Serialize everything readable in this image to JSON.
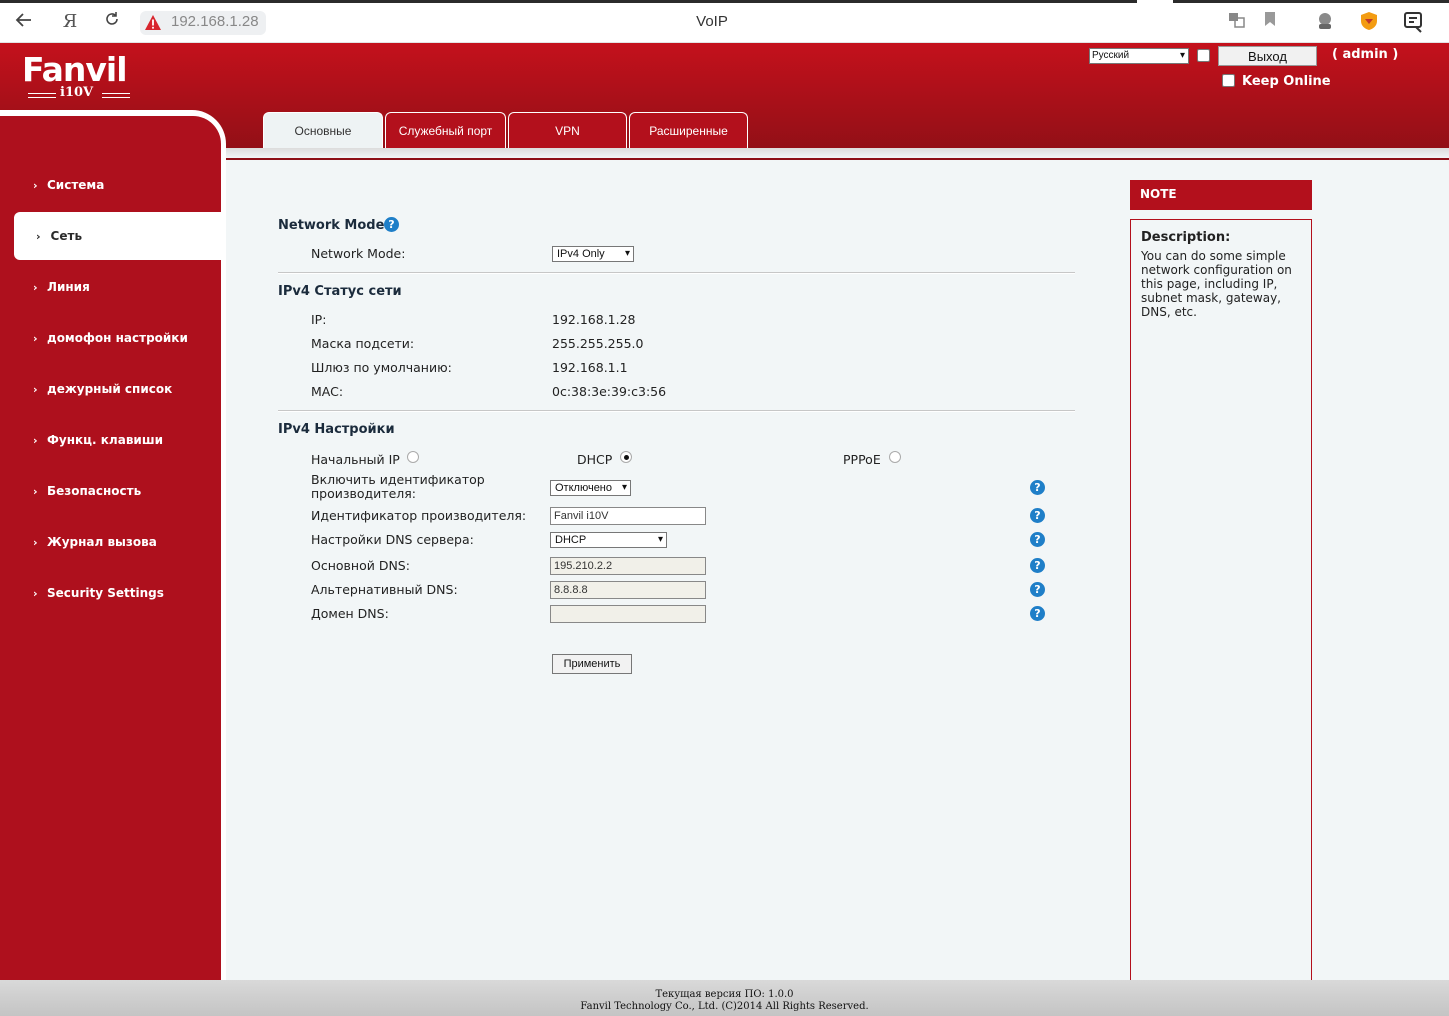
{
  "browser": {
    "url": "192.168.1.28",
    "tab_title": "VoIP",
    "icons": [
      "back-arrow-icon",
      "yandex-icon",
      "reload-icon",
      "warning-icon",
      "translate-icon",
      "bookmark-icon",
      "extension-icon",
      "shield-icon",
      "menu-icon"
    ]
  },
  "header": {
    "logo_brand": "Fanvil",
    "logo_model": "i10V",
    "language": "Русский",
    "logout_label": "Выход",
    "user_label": "( admin )",
    "keep_online_label": "Keep Online"
  },
  "tabs": [
    {
      "label": "Основные",
      "active": true
    },
    {
      "label": "Служебный порт",
      "active": false
    },
    {
      "label": "VPN",
      "active": false
    },
    {
      "label": "Расширенные",
      "active": false
    }
  ],
  "sidebar": {
    "items": [
      {
        "label": "Система"
      },
      {
        "label": "Сеть",
        "active": true
      },
      {
        "label": "Линия"
      },
      {
        "label": "домофон настройки"
      },
      {
        "label": "дежурный список"
      },
      {
        "label": "Функц. клавиши"
      },
      {
        "label": "Безопасность"
      },
      {
        "label": "Журнал вызова"
      },
      {
        "label": "Security Settings"
      }
    ]
  },
  "network_mode": {
    "title": "Network Mode",
    "label": "Network Mode:",
    "value": "IPv4 Only"
  },
  "ipv4_status": {
    "title": "IPv4 Статус сети",
    "rows": [
      {
        "label": "IP:",
        "value": "192.168.1.28"
      },
      {
        "label": "Маска подсети:",
        "value": "255.255.255.0"
      },
      {
        "label": "Шлюз по умолчанию:",
        "value": "192.168.1.1"
      },
      {
        "label": "MAC:",
        "value": "0c:38:3e:39:c3:56"
      }
    ]
  },
  "ipv4_settings": {
    "title": "IPv4 Настройки",
    "modes": [
      {
        "label": "Начальный IP",
        "selected": false
      },
      {
        "label": "DHCP",
        "selected": true
      },
      {
        "label": "PPPoE",
        "selected": false
      }
    ],
    "vendor_enable_label_1": "Включить идентификатор",
    "vendor_enable_label_2": "производителя:",
    "vendor_enable_value": "Отключено",
    "vendor_id_label": "Идентификатор производителя:",
    "vendor_id_value": "Fanvil i10V",
    "dns_mode_label": "Настройки DNS сервера:",
    "dns_mode_value": "DHCP",
    "primary_dns_label": "Основной DNS:",
    "primary_dns_value": "195.210.2.2",
    "alt_dns_label": "Альтернативный DNS:",
    "alt_dns_value": "8.8.8.8",
    "dns_domain_label": "Домен DNS:",
    "dns_domain_value": "",
    "apply_label": "Применить"
  },
  "note": {
    "header": "NOTE",
    "title": "Description:",
    "text": "You can do some simple network configuration on this page, including IP, subnet mask, gateway, DNS, etc."
  },
  "footer": {
    "line1": "Текущая версия ПО: 1.0.0",
    "line2": "Fanvil Technology Co., Ltd. (C)2014 All Rights Reserved."
  },
  "colors": {
    "brand_red": "#b3101c",
    "page_bg": "#f2f6f7",
    "help_blue": "#1f7fc8"
  }
}
